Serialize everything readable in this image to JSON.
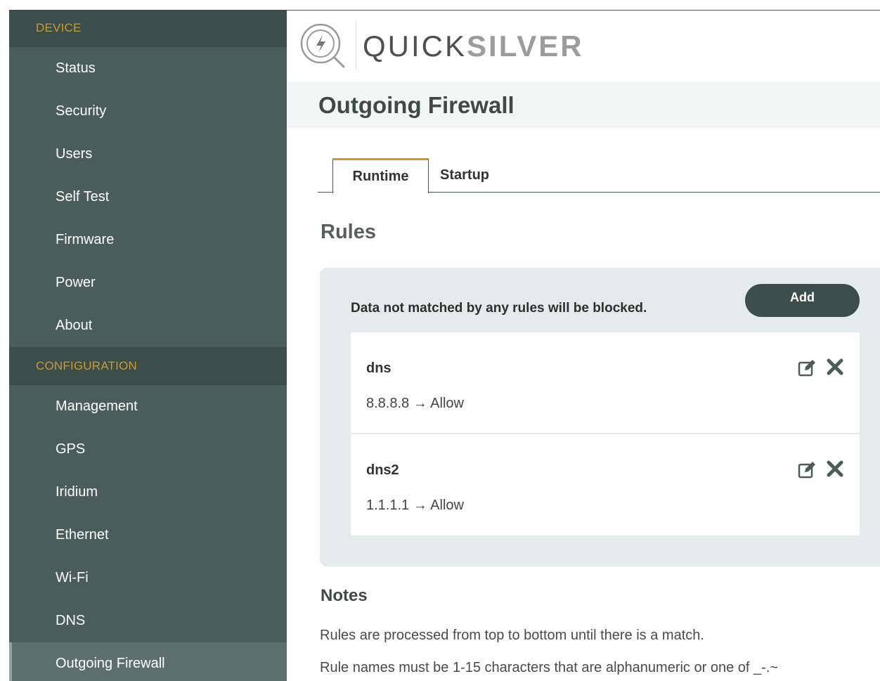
{
  "sidebar": {
    "section_device": "DEVICE",
    "device_items": [
      "Status",
      "Security",
      "Users",
      "Self Test",
      "Firmware",
      "Power",
      "About"
    ],
    "section_configuration": "CONFIGURATION",
    "config_items": [
      "Management",
      "GPS",
      "Iridium",
      "Ethernet",
      "Wi-Fi",
      "DNS",
      "Outgoing Firewall"
    ],
    "active_item": "Outgoing Firewall"
  },
  "brand": {
    "light": "QUICK",
    "bold": "SILVER",
    "icon": "lightning-magnifier-logo-icon"
  },
  "page": {
    "title": "Outgoing Firewall"
  },
  "tabs": [
    {
      "label": "Runtime",
      "active": true
    },
    {
      "label": "Startup",
      "active": false
    }
  ],
  "rules": {
    "heading": "Rules",
    "note": "Data not matched by any rules will be blocked.",
    "add_label": "Add",
    "items": [
      {
        "name": "dns",
        "detail": "8.8.8.8 → Allow"
      },
      {
        "name": "dns2",
        "detail": "1.1.1.1 → Allow"
      }
    ]
  },
  "notes": {
    "heading": "Notes",
    "lines": [
      "Rules are processed from top to bottom until there is a match.",
      "Rule names must be 1-15 characters that are alphanumeric or one of _-.~"
    ]
  },
  "colors": {
    "sidebar_bg": "#4a5d59",
    "sidebar_section_bg": "#3d4d49",
    "accent_gold": "#c49a3a",
    "panel_bg": "#e4eceb",
    "button_bg": "#3d4d49"
  }
}
